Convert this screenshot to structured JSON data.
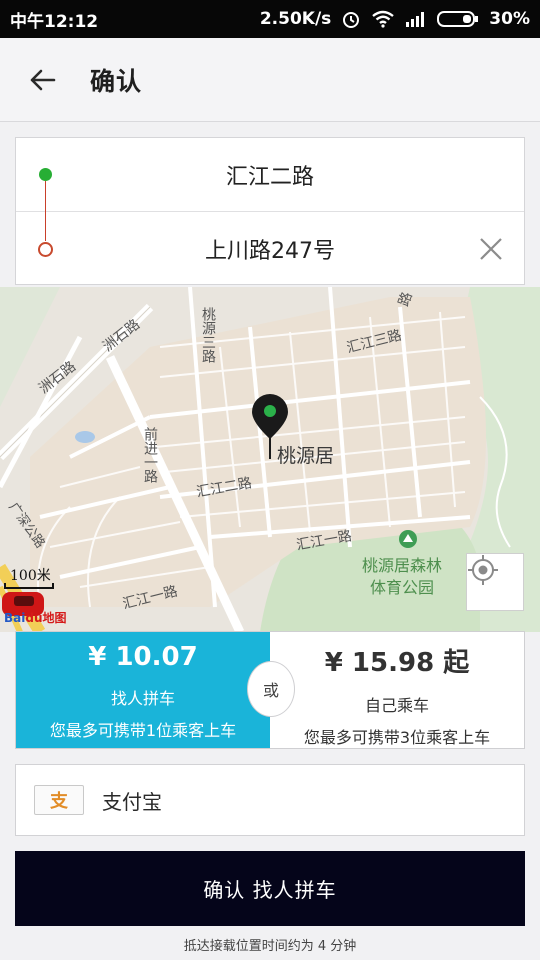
{
  "status_bar": {
    "time": "中午12:12",
    "speed": "2.50K/s",
    "battery": "30%"
  },
  "header": {
    "title": "确认"
  },
  "route": {
    "origin": "汇江二路",
    "destination": "上川路247号"
  },
  "map": {
    "pin_label": "桃源居",
    "park_label_line1": "桃源居森林",
    "park_label_line2": "体育公园",
    "scale_label": "100米",
    "logo_text": "Bai",
    "logo_text2": "du地图",
    "roads": {
      "zhoushi_1": "洲石路",
      "zhoushi_2": "洲石路",
      "taoyuan_3": "桃源三路",
      "huijiang_3": "汇江三路",
      "qianjin_1": "前进一路",
      "huijiang_2": "汇江二路",
      "huijiang_1a": "汇江一路",
      "huijiang_1b": "汇江一路",
      "guangshen": "广深公路",
      "road_top": "路"
    }
  },
  "options": {
    "carpool": {
      "price": "¥ 10.07",
      "name": "找人拼车",
      "note": "您最多可携带1位乘客上车",
      "selected": true
    },
    "or_label": "或",
    "solo": {
      "price": "¥ 15.98 起",
      "name": "自己乘车",
      "note": "您最多可携带3位乘客上车",
      "selected": false
    }
  },
  "payment": {
    "label": "支付宝",
    "icon_char": "支"
  },
  "confirm": {
    "label": "确认 找人拼车"
  },
  "eta": {
    "text": "抵达接载位置时间约为 4 分钟"
  },
  "colors": {
    "accent": "#1ab4d9",
    "confirm_bg": "#05051a",
    "origin_dot": "#27ae34",
    "dest_dot": "#c84a2e"
  },
  "icons": [
    "back-arrow-icon",
    "clear-icon",
    "locate-icon",
    "map-pin-icon",
    "alipay-icon",
    "wifi-icon",
    "signal-icon",
    "battery-icon",
    "alarm-icon"
  ]
}
